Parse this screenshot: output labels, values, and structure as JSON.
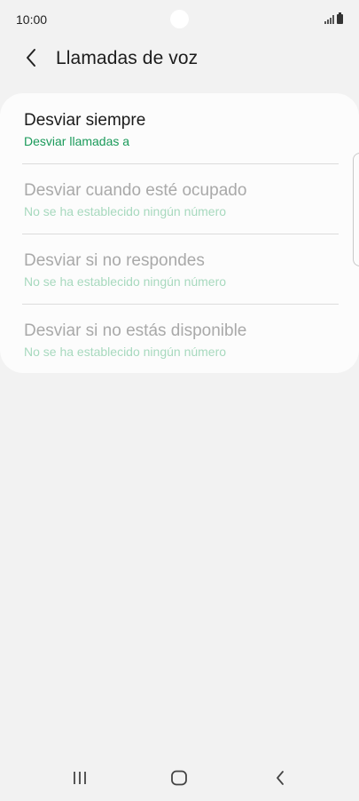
{
  "status_bar": {
    "time": "10:00"
  },
  "header": {
    "title": "Llamadas de voz",
    "back_icon": "chevron-left-icon"
  },
  "list": {
    "items": [
      {
        "title": "Desviar siempre",
        "subtitle": "Desviar llamadas a",
        "enabled": true
      },
      {
        "title": "Desviar cuando esté ocupado",
        "subtitle": "No se ha establecido ningún número",
        "enabled": false
      },
      {
        "title": "Desviar si no respondes",
        "subtitle": "No se ha establecido ningún número",
        "enabled": false
      },
      {
        "title": "Desviar si no estás disponible",
        "subtitle": "No se ha establecido ningún número",
        "enabled": false
      }
    ]
  },
  "colors": {
    "accent": "#1a9a5a",
    "background": "#f2f2f2",
    "card": "#fcfcfc"
  },
  "nav_bar": {
    "recents_icon": "recents-icon",
    "home_icon": "home-icon",
    "back_icon": "back-icon"
  }
}
